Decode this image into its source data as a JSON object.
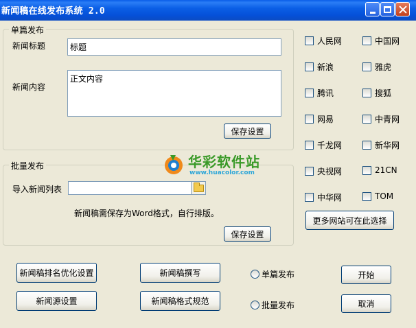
{
  "window": {
    "title": "新闻稿在线发布系统 2.0"
  },
  "single": {
    "legend": "单篇发布",
    "title_label": "新闻标题",
    "title_value": "标题",
    "content_label": "新闻内容",
    "content_value": "正文内容",
    "save_label": "保存设置"
  },
  "batch": {
    "legend": "批量发布",
    "import_label": "导入新闻列表",
    "import_value": "",
    "note": "新闻稿需保存为Word格式，自行排版。",
    "save_label": "保存设置",
    "browse_icon": "folder-open-icon"
  },
  "sites": {
    "col1": [
      "人民网",
      "新浪",
      "腾讯",
      "网易",
      "千龙网",
      "央视网",
      "中华网"
    ],
    "col2": [
      "中国网",
      "雅虎",
      "搜狐",
      "中青网",
      "新华网",
      "21CN",
      "TOM"
    ],
    "more_label": "更多网站可在此选择"
  },
  "bottom": {
    "rank_label": "新闻稿排名优化设置",
    "source_label": "新闻源设置",
    "write_label": "新闻稿撰写",
    "format_label": "新闻稿格式规范",
    "radio_single": "单篇发布",
    "radio_batch": "批量发布",
    "start_label": "开始",
    "cancel_label": "取消"
  },
  "watermark": {
    "cn": "华彩软件站",
    "url": "www.huacolor.com"
  },
  "colors": {
    "titlebar": "#0a5ee8",
    "window_bg": "#ece9d8",
    "button_border": "#003c74"
  }
}
